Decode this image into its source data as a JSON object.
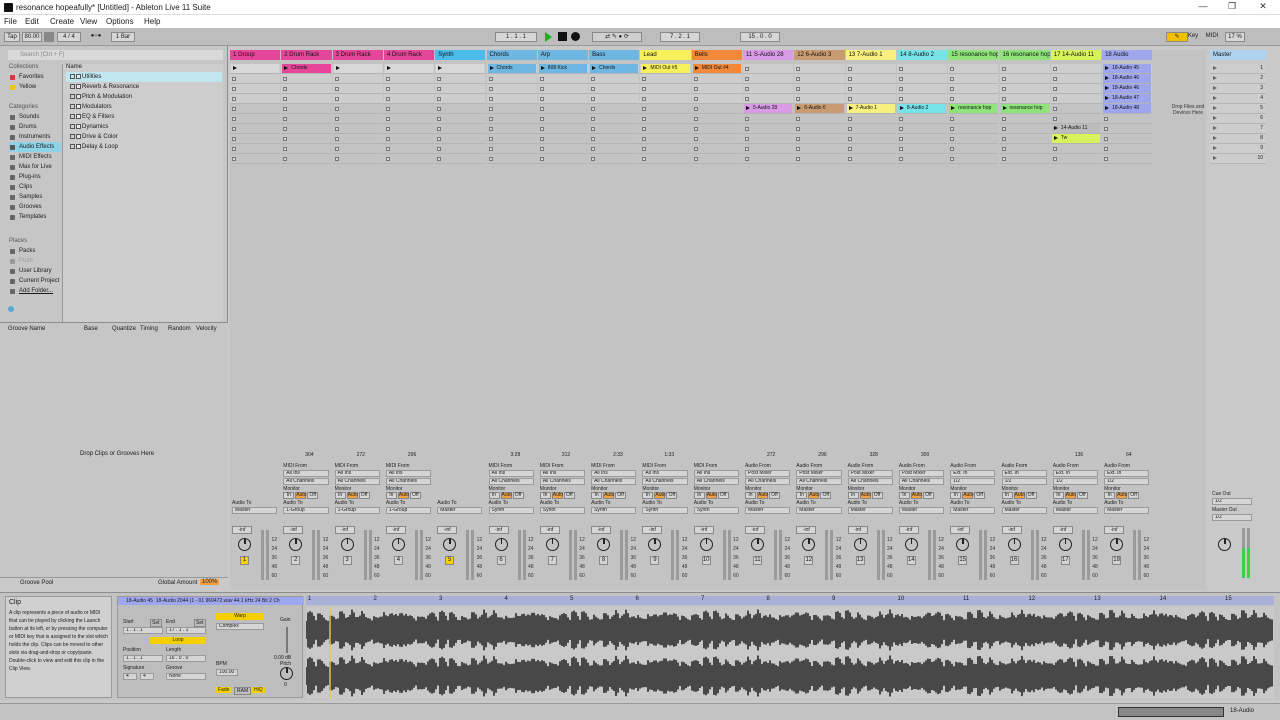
{
  "window": {
    "title": "resonance hopeafully* [Untitled] - Ableton Live 11 Suite",
    "min": "—",
    "max": "❐",
    "close": "✕"
  },
  "menu": [
    "File",
    "Edit",
    "Create",
    "View",
    "Options",
    "Help"
  ],
  "control": {
    "tap": "Tap",
    "bpm": "80.00",
    "sig": "4 / 4",
    "quant": "1 Bar",
    "pos": "1 . 1 . 1",
    "loop_start": "7 . 2 . 1",
    "loop_len": "15 . 0 . 0",
    "key": "Key",
    "midi": "MIDI",
    "cpu": "17 %"
  },
  "browser": {
    "search": "Search (Ctrl + F)",
    "collections_title": "Collections",
    "collections": [
      {
        "label": "Favorites",
        "color": "#e0303a"
      },
      {
        "label": "Yellow",
        "color": "#f2c400"
      }
    ],
    "categories_title": "Categories",
    "categories": [
      "Sounds",
      "Drums",
      "Instruments",
      "Audio Effects",
      "MIDI Effects",
      "Max for Live",
      "Plug-ins",
      "Clips",
      "Samples",
      "Grooves",
      "Templates"
    ],
    "places_title": "Places",
    "places": [
      "Packs",
      "Push",
      "User Library",
      "Current Project",
      "Add Folder..."
    ],
    "name_header": "Name",
    "items": [
      "Utilities",
      "Reverb & Resonance",
      "Pitch & Modulation",
      "Modulators",
      "EQ & Filters",
      "Dynamics",
      "Drive & Color",
      "Delay & Loop"
    ]
  },
  "groove": {
    "headers": [
      "Groove Name",
      "Base",
      "Quantize",
      "Timing",
      "Random",
      "Velocity"
    ],
    "drop": "Drop Clips or Grooves Here",
    "pool": "Groove Pool",
    "global": "Global Amount",
    "global_val": "100%"
  },
  "tracks": [
    {
      "name": "1 Group",
      "color": "#e6469a",
      "num": "1",
      "type": "group"
    },
    {
      "name": "2 Drum Rack",
      "color": "#e6469a",
      "num": "2",
      "type": "midi"
    },
    {
      "name": "3 Drum Rack",
      "color": "#e6469a",
      "num": "3",
      "type": "midi"
    },
    {
      "name": "4 Drum Rack",
      "color": "#e6469a",
      "num": "4",
      "type": "midi"
    },
    {
      "name": "Synth",
      "color": "#4bbbe9",
      "num": "5",
      "type": "group"
    },
    {
      "name": "Chords",
      "color": "#6fb7e3",
      "num": "6",
      "type": "midi"
    },
    {
      "name": "Arp",
      "color": "#6fb7e3",
      "num": "7",
      "type": "midi"
    },
    {
      "name": "Bass",
      "color": "#6fb7e3",
      "num": "8",
      "type": "midi"
    },
    {
      "name": "Lead",
      "color": "#f6f15a",
      "num": "9",
      "type": "midi"
    },
    {
      "name": "Bells",
      "color": "#f1883a",
      "num": "10",
      "type": "midi"
    },
    {
      "name": "11 S-Audio 28",
      "color": "#d99ae6",
      "num": "11",
      "type": "audio"
    },
    {
      "name": "12 6-Audio 3",
      "color": "#c89b71",
      "num": "12",
      "type": "audio"
    },
    {
      "name": "13 7-Audio 1",
      "color": "#f8f07e",
      "num": "13",
      "type": "audio"
    },
    {
      "name": "14 8-Audio 2",
      "color": "#75e3e8",
      "num": "14",
      "type": "audio"
    },
    {
      "name": "15 resonance hop",
      "color": "#8ee47a",
      "num": "15",
      "type": "audio"
    },
    {
      "name": "16 resonance hop",
      "color": "#8ee47a",
      "num": "16",
      "type": "audio"
    },
    {
      "name": "17 14-Audio 11",
      "color": "#d7f35c",
      "num": "17",
      "type": "audio"
    },
    {
      "name": "18 Audio",
      "color": "#9ea6ee",
      "num": "18",
      "type": "audio"
    }
  ],
  "clips": {
    "row0": [
      "",
      "Chords",
      "",
      "",
      "",
      "Chords",
      "808 Kick",
      "Chords",
      "MIDI Out #5",
      "MIDI Out #4"
    ],
    "row4": [
      "5-Audio 28",
      "6-Audio 6",
      "7-Audio 1",
      "8-Audio 2",
      "resonance hop",
      "resonance hop"
    ],
    "t17": [
      "14-Audio 11",
      "Tw"
    ],
    "t18": [
      "18-Audio 45",
      "18-Audio 46",
      "18-Audio 46",
      "18-Audio 47",
      "18-Audio 48"
    ]
  },
  "drop_files": "Drop Files and Devices Here",
  "master": {
    "name": "Master",
    "scenes": [
      "1",
      "2",
      "3",
      "4",
      "5",
      "6",
      "7",
      "8",
      "9",
      "10"
    ],
    "cue_out": "Cue Out",
    "cue_val": "1/2",
    "master_out": "Master Out",
    "master_val": "1/2"
  },
  "io": {
    "midi_from": "MIDI From",
    "audio_from": "Audio From",
    "all_ins": "All Ins",
    "all_channels": "All Channels",
    "monitor": "Monitor",
    "in": "In",
    "auto": "Auto",
    "off": "Off",
    "audio_to": "Audio To",
    "master": "Master",
    "group1": "1-Group",
    "synth": "Synth",
    "ext_in": "Ext. In",
    "post_mixer": "Post Mixer",
    "half": "1/2",
    "inf": "-inf"
  },
  "clipcounts": [
    "304",
    "272",
    "296",
    "3:28",
    "312",
    "2:33",
    "1:33",
    "272",
    "296",
    "328",
    "300",
    "136",
    "64"
  ],
  "clip_panel": {
    "title": "Clip",
    "text": "A clip represents a piece of audio or MIDI that can be played by clicking the Launch button at its left, or by pressing the computer or MIDI key that is assigned to the slot which holds the clip. Clips can be moved to other slots via drag-and-drop or copy/paste. Double-click to view and edit this clip in the Clip View."
  },
  "clip_detail": {
    "name": "18-Audio 45",
    "info": "18-Audio 2044 (1 - 01 960472.wav   44.1 kHz   24 Bit   2 Ch",
    "start": "Start",
    "end": "End",
    "set": "Set",
    "loop": "Loop",
    "position": "Position",
    "length": "Length",
    "signature": "Signature",
    "groove": "Groove",
    "sig_n": "4",
    "sig_d": "4",
    "none": "None",
    "warp": "Warp",
    "complex": "Complex",
    "bpm_label": "BPM",
    "bpm": "100.00",
    "gain": "Gain",
    "gain_val": "0.00 dB",
    "pitch": "Pitch",
    "pitch_val": "0",
    "fade": "Fade",
    "ram": "RAM",
    "hiq": "HiQ",
    "start_val": "1 . 1 . 1",
    "end_val": "17 . 1 . 1",
    "length_val": "16 . 0 . 0"
  },
  "ruler": [
    "1",
    "2",
    "3",
    "4",
    "5",
    "6",
    "7",
    "8",
    "9",
    "10",
    "11",
    "12",
    "13",
    "14",
    "15"
  ],
  "status": {
    "track": "18-Audio"
  }
}
